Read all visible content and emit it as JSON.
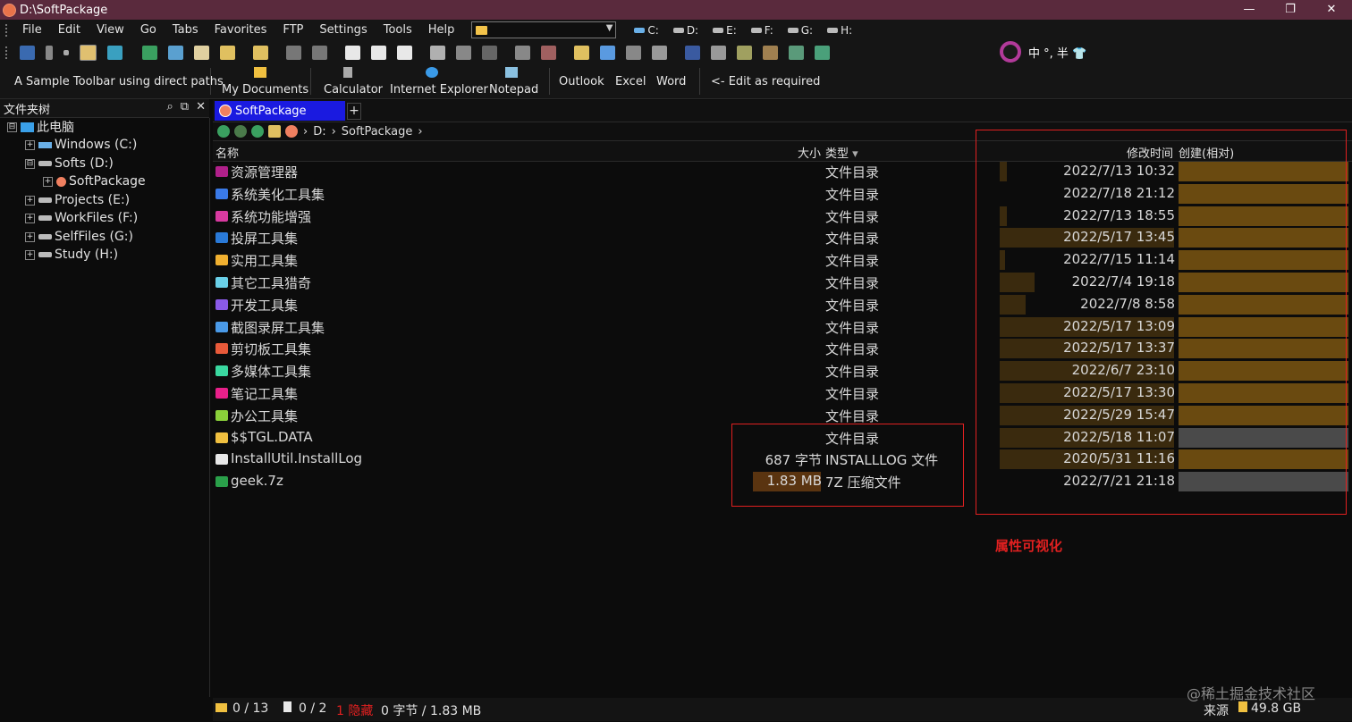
{
  "window": {
    "title": "D:\\SoftPackage",
    "controls": [
      "—",
      "❐",
      "✕"
    ]
  },
  "menu": {
    "items": [
      "File",
      "Edit",
      "View",
      "Go",
      "Tabs",
      "Favorites",
      "FTP",
      "Settings",
      "Tools",
      "Help"
    ],
    "drives": [
      "C:",
      "D:",
      "E:",
      "F:",
      "G:",
      "H:"
    ]
  },
  "ime": {
    "text": "中 °, 半 👕"
  },
  "toolbar2": {
    "sample": "A Sample Toolbar using direct paths",
    "my_documents": "My Documents",
    "calculator": "Calculator",
    "ie": "Internet Explorer",
    "notepad": "Notepad",
    "outlook": "Outlook",
    "excel": "Excel",
    "word": "Word",
    "edit_hint": "<- Edit as required"
  },
  "tree": {
    "header": "文件夹树",
    "nodes": [
      {
        "label": "此电脑",
        "expander": "⊟"
      },
      {
        "label": "Windows (C:)",
        "expander": "+"
      },
      {
        "label": "Softs (D:)",
        "expander": "⊟"
      },
      {
        "label": "SoftPackage",
        "expander": "+"
      },
      {
        "label": "Projects (E:)",
        "expander": "+"
      },
      {
        "label": "WorkFiles (F:)",
        "expander": "+"
      },
      {
        "label": "SelfFiles (G:)",
        "expander": "+"
      },
      {
        "label": "Study (H:)",
        "expander": "+"
      }
    ]
  },
  "tab": {
    "label": "SoftPackage",
    "plus": "+"
  },
  "address": {
    "drive": "D:",
    "folder": "SoftPackage",
    "sep": "›"
  },
  "columns": {
    "name": "名称",
    "size": "大小",
    "type": "类型",
    "modified": "修改时间",
    "created": "创建(相对)"
  },
  "rows": [
    {
      "name": "资源管理器",
      "size": "",
      "type": "文件目录",
      "modified": "2022/7/13 10:32",
      "icon_color": "#b0208a",
      "mbar": 0.04,
      "cbar": "#6a4a10"
    },
    {
      "name": "系统美化工具集",
      "size": "",
      "type": "文件目录",
      "modified": "2022/7/18 21:12",
      "icon_color": "#3a7ae8",
      "mbar": 0.0,
      "cbar": "#6a4a10"
    },
    {
      "name": "系统功能增强",
      "size": "",
      "type": "文件目录",
      "modified": "2022/7/13 18:55",
      "icon_color": "#d83aa0",
      "mbar": 0.04,
      "cbar": "#6a4a10"
    },
    {
      "name": "投屏工具集",
      "size": "",
      "type": "文件目录",
      "modified": "2022/5/17 13:45",
      "icon_color": "#2a7ad8",
      "mbar": 1.0,
      "cbar": "#6a4a10"
    },
    {
      "name": "实用工具集",
      "size": "",
      "type": "文件目录",
      "modified": "2022/7/15 11:14",
      "icon_color": "#f0b030",
      "mbar": 0.02,
      "cbar": "#6a4a10"
    },
    {
      "name": "其它工具猎奇",
      "size": "",
      "type": "文件目录",
      "modified": "2022/7/4 19:18",
      "icon_color": "#6ad0e8",
      "mbar": 0.2,
      "cbar": "#6a4a10"
    },
    {
      "name": "开发工具集",
      "size": "",
      "type": "文件目录",
      "modified": "2022/7/8  8:58",
      "icon_color": "#8a5ae8",
      "mbar": 0.15,
      "cbar": "#6a4a10"
    },
    {
      "name": "截图录屏工具集",
      "size": "",
      "type": "文件目录",
      "modified": "2022/5/17 13:09",
      "icon_color": "#4a9ae8",
      "mbar": 1.0,
      "cbar": "#6a4a10"
    },
    {
      "name": "剪切板工具集",
      "size": "",
      "type": "文件目录",
      "modified": "2022/5/17 13:37",
      "icon_color": "#e85a3a",
      "mbar": 1.0,
      "cbar": "#6a4a10"
    },
    {
      "name": "多媒体工具集",
      "size": "",
      "type": "文件目录",
      "modified": "2022/6/7 23:10",
      "icon_color": "#3ad8a0",
      "mbar": 1.0,
      "cbar": "#6a4a10"
    },
    {
      "name": "笔记工具集",
      "size": "",
      "type": "文件目录",
      "modified": "2022/5/17 13:30",
      "icon_color": "#e8208a",
      "mbar": 1.0,
      "cbar": "#6a4a10"
    },
    {
      "name": "办公工具集",
      "size": "",
      "type": "文件目录",
      "modified": "2022/5/29 15:47",
      "icon_color": "#8ad03a",
      "mbar": 1.0,
      "cbar": "#6a4a10"
    },
    {
      "name": "$$TGL.DATA",
      "size": "",
      "type": "文件目录",
      "modified": "2022/5/18 11:07",
      "icon_color": "#f0c040",
      "mbar": 1.0,
      "cbar": "#4a4a4a"
    },
    {
      "name": "InstallUtil.InstallLog",
      "size": "687 字节",
      "type": "INSTALLLOG 文件",
      "modified": "2020/5/31 11:16",
      "icon_color": "#e8e8e8",
      "mbar": 1.0,
      "cbar": "#6a4a10"
    },
    {
      "name": "geek.7z",
      "size": "1.83 MB",
      "type": "7Z 压缩文件",
      "modified": "2022/7/21 21:18",
      "icon_color": "#2aa04a",
      "mbar": 0.0,
      "cbar": "#4a4a4a"
    }
  ],
  "annotation": {
    "label": "属性可视化"
  },
  "status": {
    "folders": "0 / 13",
    "files": "0 / 2",
    "hidden": "1 隐藏",
    "bytes": "0 字节 / 1.83 MB",
    "source": "来源",
    "free": "49.8 GB"
  },
  "watermark": "@稀土掘金技术社区",
  "colors": {
    "tab_active": "#1a1ae0",
    "titlebar": "#5a2a3d",
    "annotation": "#e02020"
  }
}
